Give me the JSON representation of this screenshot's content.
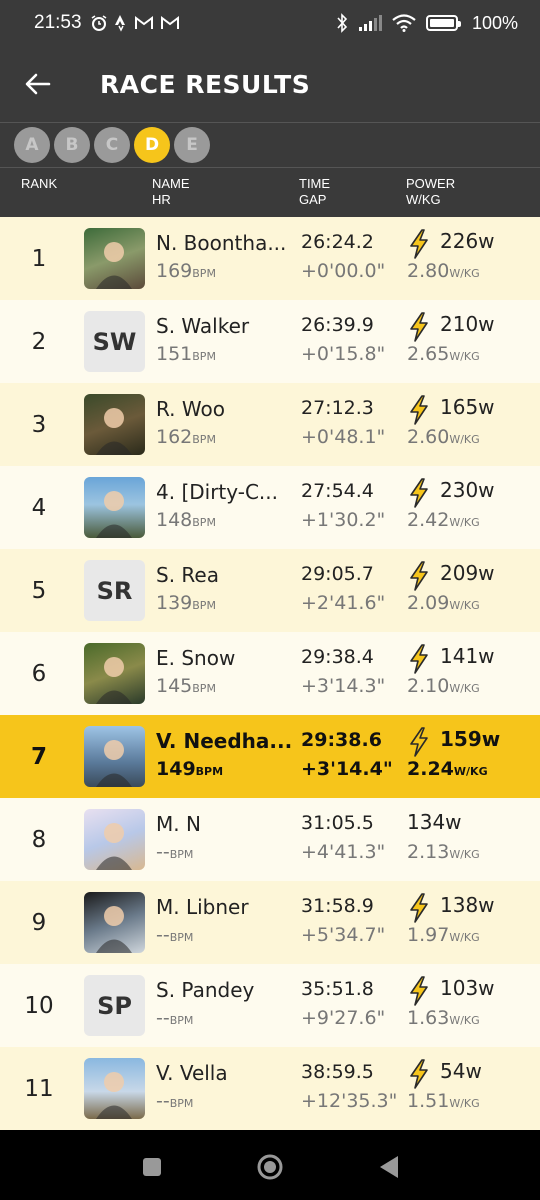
{
  "status_bar": {
    "time": "21:53",
    "battery": "100%",
    "left_icons": [
      "alarm-icon",
      "strava-icon",
      "gmail-icon",
      "gmail-icon"
    ],
    "right_icons": [
      "bluetooth-icon",
      "signal-icon",
      "wifi-icon",
      "battery-icon"
    ]
  },
  "header": {
    "title": "RACE RESULTS"
  },
  "tabs": [
    {
      "label": "A",
      "active": false
    },
    {
      "label": "B",
      "active": false
    },
    {
      "label": "C",
      "active": false
    },
    {
      "label": "D",
      "active": true
    },
    {
      "label": "E",
      "active": false
    }
  ],
  "columns": {
    "rank": "RANK",
    "name": "NAME",
    "hr": "HR",
    "time": "TIME",
    "gap": "GAP",
    "power": "POWER",
    "wkg": "W/KG"
  },
  "units": {
    "bpm": "BPM",
    "wkg": "W/KG"
  },
  "accent_color": "#f6c51b",
  "results": [
    {
      "rank": "1",
      "name": "N. Boontha...",
      "hr": "169",
      "time": "26:24.2",
      "gap": "+0'00.0\"",
      "watts": "226w",
      "wkg": "2.80",
      "avatar": "photo",
      "bolt": true
    },
    {
      "rank": "2",
      "name": "S. Walker",
      "hr": "151",
      "time": "26:39.9",
      "gap": "+0'15.8\"",
      "watts": "210w",
      "wkg": "2.65",
      "avatar": "SW",
      "bolt": true
    },
    {
      "rank": "3",
      "name": "R. Woo",
      "hr": "162",
      "time": "27:12.3",
      "gap": "+0'48.1\"",
      "watts": "165w",
      "wkg": "2.60",
      "avatar": "photo",
      "bolt": true
    },
    {
      "rank": "4",
      "name": "4. [Dirty-C...",
      "hr": "148",
      "time": "27:54.4",
      "gap": "+1'30.2\"",
      "watts": "230w",
      "wkg": "2.42",
      "avatar": "photo",
      "bolt": true
    },
    {
      "rank": "5",
      "name": "S. Rea",
      "hr": "139",
      "time": "29:05.7",
      "gap": "+2'41.6\"",
      "watts": "209w",
      "wkg": "2.09",
      "avatar": "SR",
      "bolt": true
    },
    {
      "rank": "6",
      "name": "E. Snow",
      "hr": "145",
      "time": "29:38.4",
      "gap": "+3'14.3\"",
      "watts": "141w",
      "wkg": "2.10",
      "avatar": "photo",
      "bolt": true
    },
    {
      "rank": "7",
      "name": "V. Needha...",
      "hr": "149",
      "time": "29:38.6",
      "gap": "+3'14.4\"",
      "watts": "159w",
      "wkg": "2.24",
      "avatar": "photo",
      "bolt": true,
      "me": true
    },
    {
      "rank": "8",
      "name": "M.  N",
      "hr": "--",
      "time": "31:05.5",
      "gap": "+4'41.3\"",
      "watts": "134w",
      "wkg": "2.13",
      "avatar": "photo",
      "bolt": false
    },
    {
      "rank": "9",
      "name": "M. Libner",
      "hr": "--",
      "time": "31:58.9",
      "gap": "+5'34.7\"",
      "watts": "138w",
      "wkg": "1.97",
      "avatar": "photo",
      "bolt": true
    },
    {
      "rank": "10",
      "name": "S. Pandey",
      "hr": "--",
      "time": "35:51.8",
      "gap": "+9'27.6\"",
      "watts": "103w",
      "wkg": "1.63",
      "avatar": "SP",
      "bolt": true
    },
    {
      "rank": "11",
      "name": "V. Vella",
      "hr": "--",
      "time": "38:59.5",
      "gap": "+12'35.3\"",
      "watts": "54w",
      "wkg": "1.51",
      "avatar": "photo",
      "bolt": true
    }
  ],
  "nav": [
    "recents-button",
    "home-button",
    "back-button"
  ]
}
